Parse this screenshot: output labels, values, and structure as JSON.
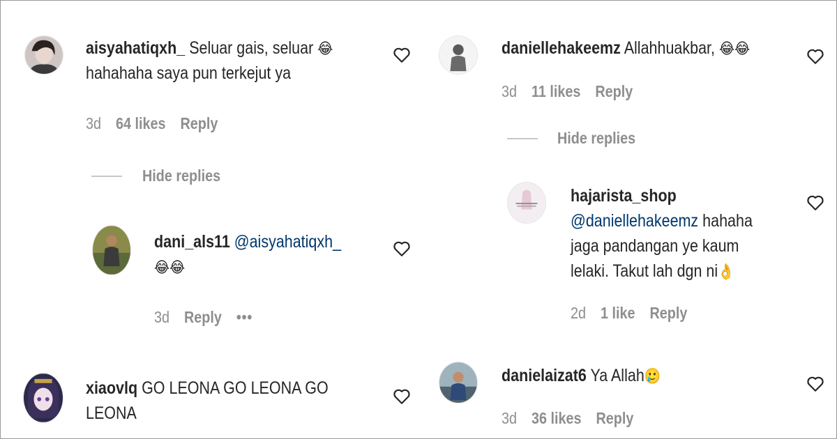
{
  "left_column": {
    "comment1": {
      "username": "aisyahatiqxh_",
      "text_line1": "Seluar gais, seluar ",
      "emoji": "😂",
      "text_line2": "hahahaha saya pun terkejut ya",
      "time": "3d",
      "likes": "64 likes",
      "reply": "Reply",
      "avatar_icon": "avatar-photo"
    },
    "hide_replies_1": "Hide replies",
    "reply1": {
      "username": "dani_als11",
      "mention": "@aisyahatiqxh_",
      "emojis": "😂😂",
      "time": "3d",
      "reply": "Reply",
      "more": "•••",
      "avatar_icon": "avatar-photo"
    },
    "comment2": {
      "username": "xiaovlq",
      "text_line1": "GO LEONA GO LEONA GO",
      "text_line2": "LEONA",
      "avatar_icon": "avatar-anime"
    }
  },
  "right_column": {
    "comment3": {
      "username": "daniellehakeemz",
      "text": "Allahhuakbar, ",
      "emojis": "😂😂",
      "time": "3d",
      "likes": "11 likes",
      "reply": "Reply",
      "avatar_icon": "avatar-photo"
    },
    "hide_replies_2": "Hide replies",
    "reply2": {
      "username": "hajarista_shop",
      "mention": "@daniellehakeemz",
      "text_line1": " hahaha",
      "text_line2": "jaga pandangan ye kaum",
      "text_line3": "lelaki. Takut lah dgn ni",
      "emoji": "👌",
      "time": "2d",
      "likes": "1 like",
      "reply": "Reply",
      "avatar_icon": "avatar-shop-logo"
    },
    "comment4": {
      "username": "danielaizat6",
      "text": "Ya Allah",
      "emoji": "🥲",
      "time": "3d",
      "likes": "36 likes",
      "reply": "Reply",
      "avatar_icon": "avatar-photo"
    }
  },
  "colors": {
    "text": "#262626",
    "secondary": "#8e8e8e",
    "mention": "#00376b",
    "divider": "#c7c7c7"
  }
}
